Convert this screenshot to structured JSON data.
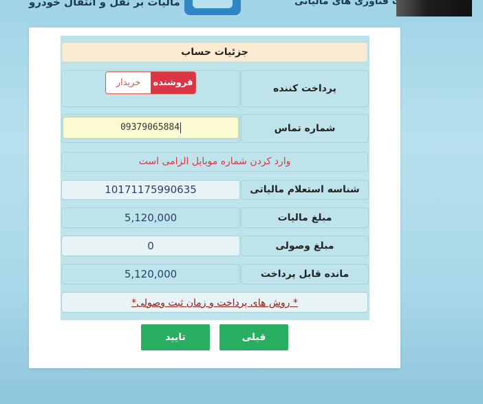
{
  "header": {
    "title_left": "سامانه مالیات بر نقل و انتقال خودرو",
    "title_right": "معاونت فناوری های مالیاتی"
  },
  "form": {
    "title": "جزئیات حساب",
    "payer": {
      "label": "پرداخت کننده",
      "options": [
        "خریدار",
        "فروشنده"
      ],
      "selected": "فروشنده"
    },
    "phone": {
      "label": "شماره تماس",
      "value": "09379065884",
      "error": "وارد کردن شماره موبایل الزامی است"
    },
    "rows": [
      {
        "label": "شناسه استعلام مالیاتی",
        "value": "10171175990635"
      },
      {
        "label": "مبلغ مالیات",
        "value": "5,120,000"
      },
      {
        "label": "مبلغ وصولی",
        "value": "0"
      },
      {
        "label": "مانده قابل پرداخت",
        "value": "5,120,000"
      }
    ],
    "payment_link": "*روش های پرداخت و زمان ثبت وصولی *"
  },
  "buttons": {
    "confirm": "تایید",
    "previous": "قبلی"
  },
  "colors": {
    "primary": "#27ae60",
    "danger": "#dc3545",
    "panel": "#bfe3ea",
    "title_bg": "#fcebd2"
  }
}
